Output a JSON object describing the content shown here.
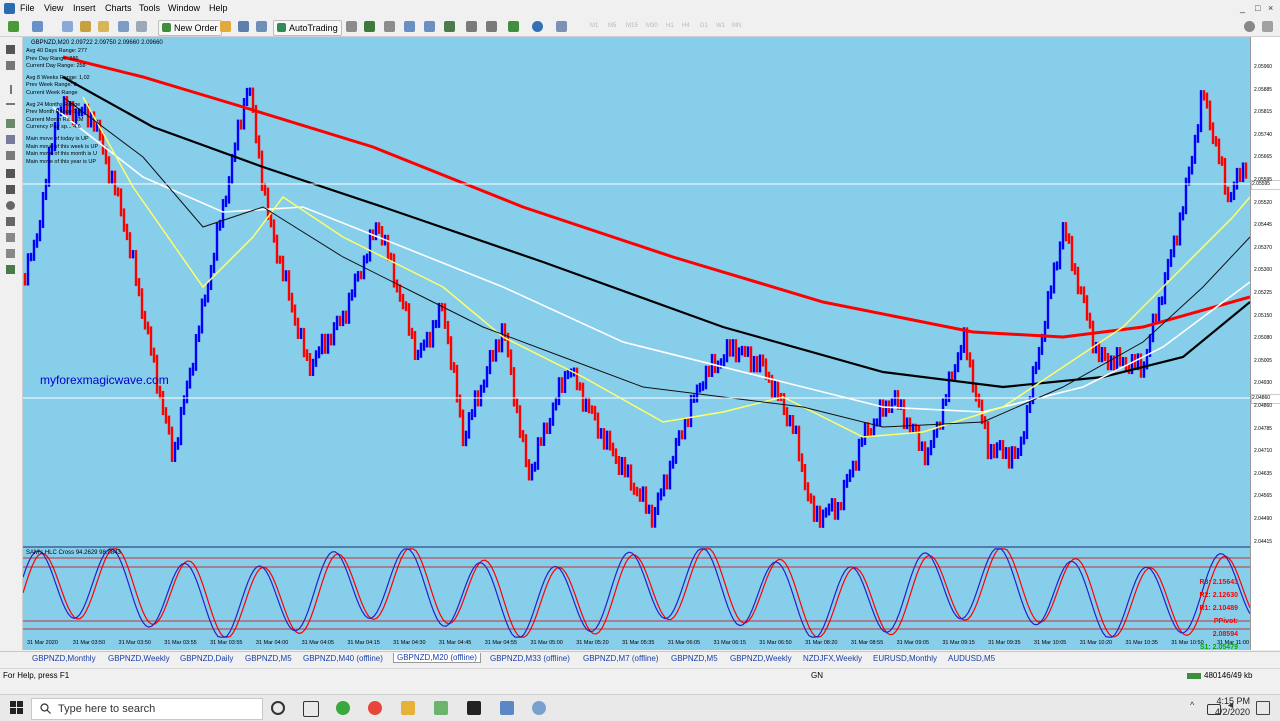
{
  "menubar": {
    "items": [
      "File",
      "View",
      "Insert",
      "Charts",
      "Tools",
      "Window",
      "Help"
    ],
    "window_controls": [
      "_",
      "□",
      "×"
    ]
  },
  "toolbar": {
    "new_order_label": "New Order",
    "autotrading_label": "AutoTrading",
    "timeframes": [
      "M1",
      "M5",
      "M15",
      "M30",
      "H1",
      "H4",
      "D1",
      "W1",
      "MN"
    ]
  },
  "chart": {
    "header": "GBPNZD,M20  2.09722 2.09750 2.09660 2.09660",
    "info_lines": [
      "Avg 40 Days Range: 277",
      "Prev Day Range: 286",
      "Current Day Range: 258",
      "Avg 8 Weeks Range: 1,02",
      "Prev Week Range: 8",
      "Current Week Range",
      "Avg 24 Months Range",
      "Prev Month Range 1,6..",
      "Current Month Ra... 2M",
      "Currency Pair sp... 4.6",
      "Main move of today is UP",
      "Main move of this week is UP",
      "Main move of this month is U",
      "Main move of this year is UP"
    ],
    "watermark": "myforexmagicwave.com",
    "price_axis": [
      "2.05960",
      "2.05885",
      "2.05815",
      "2.05740",
      "2.05665",
      "2.05595",
      "2.05520",
      "2.05445",
      "2.05370",
      "2.05300",
      "2.05225",
      "2.05150",
      "2.05080",
      "2.05005",
      "2.04930",
      "2.04860",
      "2.04785",
      "2.04710",
      "2.04635",
      "2.04565",
      "2.04490",
      "2.04415"
    ],
    "price_marker_high": "2.05595",
    "price_marker_low": "2.04860",
    "bar_colors": {
      "up": "#0000ff",
      "down": "#ff0000",
      "background": "#87ceeb"
    },
    "ma_colors": [
      "#ff0000",
      "#000000",
      "#ffffff",
      "#ffff66",
      "#111111"
    ]
  },
  "indicator": {
    "header": "SAM's HLC Cross 94.2629 98.0843",
    "levels": [
      {
        "label": "R3: 2.15643",
        "color": "#ff0000"
      },
      {
        "label": "R2: 2.12630",
        "color": "#ff0000"
      },
      {
        "label": "R1: 2.10489",
        "color": "#ff0000"
      },
      {
        "label": "PPivot: 2.08594",
        "color": "#ff0000"
      },
      {
        "label": "S1: 2.05479",
        "color": "#00aa00"
      }
    ]
  },
  "time_axis": [
    "31 Mar 2020",
    "31 Mar 03:50",
    "31 Mar 03:50",
    "31 Mar 03:55",
    "31 Mar 03:55",
    "31 Mar 04:00",
    "31 Mar 04:05",
    "31 Mar 04:15",
    "31 Mar 04:30",
    "31 Mar 04:45",
    "31 Mar 04:55",
    "31 Mar 05:00",
    "31 Mar 05:20",
    "31 Mar 05:35",
    "31 Mar 06:05",
    "31 Mar 06:15",
    "31 Mar 06:50",
    "31 Mar 08:20",
    "31 Mar 08:55",
    "31 Mar 09:05",
    "31 Mar 09:15",
    "31 Mar 09:35",
    "31 Mar 10:05",
    "31 Mar 10:20",
    "31 Mar 10:35",
    "31 Mar 10:50",
    "31 Mar 11:00"
  ],
  "tabs": [
    {
      "label": "GBPNZD,Monthly",
      "active": false
    },
    {
      "label": "GBPNZD,Weekly",
      "active": false
    },
    {
      "label": "GBPNZD,Daily",
      "active": false
    },
    {
      "label": "GBPNZD,M5",
      "active": false
    },
    {
      "label": "GBPNZD,M40 (offline)",
      "active": false
    },
    {
      "label": "GBPNZD,M20 (offline)",
      "active": true
    },
    {
      "label": "GBPNZD,M33 (offline)",
      "active": false
    },
    {
      "label": "GBPNZD,M7 (offline)",
      "active": false
    },
    {
      "label": "GBPNZD,M5",
      "active": false
    },
    {
      "label": "GBPNZD,Weekly",
      "active": false
    },
    {
      "label": "NZDJFX,Weekly",
      "active": false
    },
    {
      "label": "EURUSD,Monthly",
      "active": false
    },
    {
      "label": "AUDUSD,M5",
      "active": false
    }
  ],
  "status": {
    "help": "For Help, press F1",
    "profile": "GN",
    "memory": "480146/49 kb"
  },
  "taskbar": {
    "search_placeholder": "Type here to search",
    "time": "4:15 PM",
    "date": "4/2/2020"
  }
}
